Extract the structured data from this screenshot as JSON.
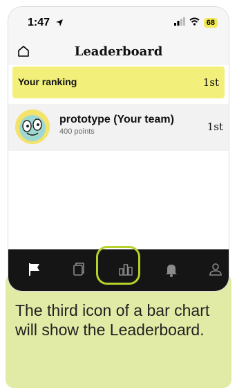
{
  "status_bar": {
    "time": "1:47",
    "battery": "68"
  },
  "header": {
    "title": "Leaderboard"
  },
  "ranking": {
    "label": "Your ranking",
    "value": "1st"
  },
  "team": {
    "name": "prototype  (Your team)",
    "points": "400 points",
    "rank": "1st"
  },
  "tabs": [
    "flag-icon",
    "cards-icon",
    "bar-chart-icon",
    "bell-icon",
    "profile-icon"
  ],
  "colors": {
    "ranking_highlight": "#f2f07a",
    "tab_bar": "#151515",
    "callout": "#e2eba6",
    "focus_ring": "#b8d12a"
  },
  "callout": {
    "text": "The third icon of a bar chart will show the Leaderboard."
  }
}
